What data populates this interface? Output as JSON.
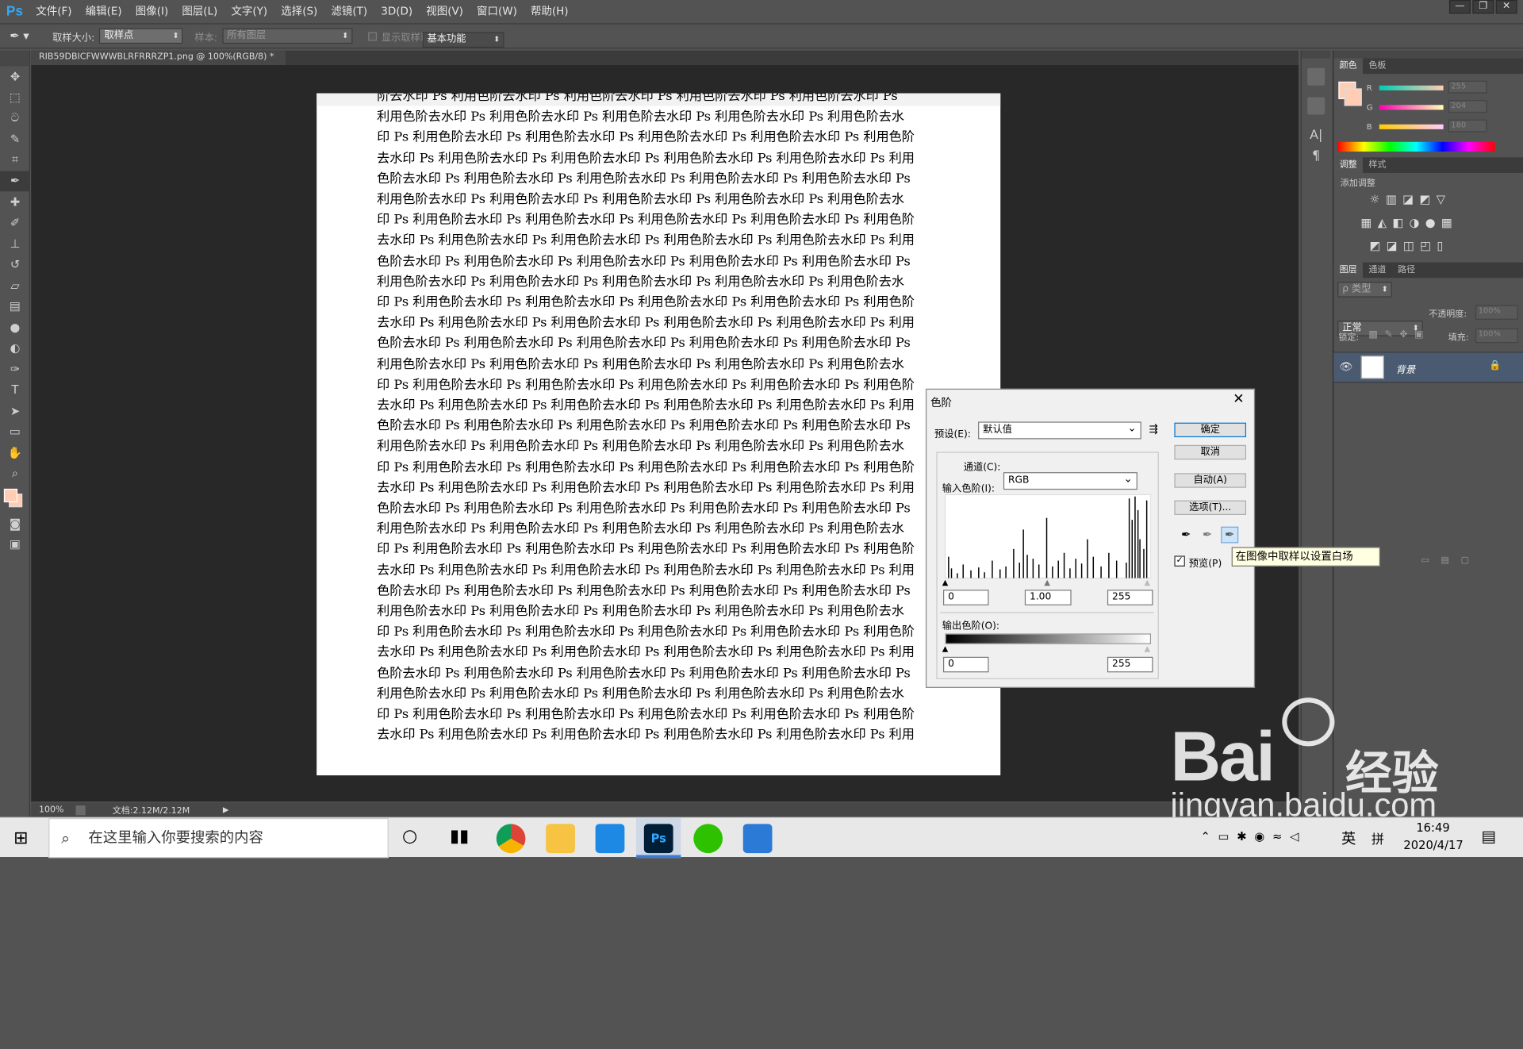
{
  "app": {
    "logo": "Ps"
  },
  "menu": [
    "文件(F)",
    "编辑(E)",
    "图像(I)",
    "图层(L)",
    "文字(Y)",
    "选择(S)",
    "滤镜(T)",
    "3D(D)",
    "视图(V)",
    "窗口(W)",
    "帮助(H)"
  ],
  "options": {
    "sample_size_label": "取样大小:",
    "sample_size_value": "取样点",
    "sample_label": "样本:",
    "sample_value": "所有图层",
    "show_ring": "显示取样环",
    "workspace": "基本功能"
  },
  "document": {
    "tab_title": "RIB59DBICFWWWBLRFRRRZP1.png @ 100%(RGB/8) *",
    "lines": [
      "阶去水印 Ps 利用色阶去水印 Ps 利用色阶去水印 Ps 利用色阶去水印 Ps 利用色阶去水印 Ps",
      "利用色阶去水印 Ps 利用色阶去水印 Ps 利用色阶去水印 Ps 利用色阶去水印 Ps 利用色阶去水",
      "印 Ps 利用色阶去水印 Ps 利用色阶去水印 Ps 利用色阶去水印 Ps 利用色阶去水印 Ps 利用色阶",
      "去水印 Ps 利用色阶去水印 Ps 利用色阶去水印 Ps 利用色阶去水印 Ps 利用色阶去水印 Ps 利用",
      "色阶去水印 Ps 利用色阶去水印 Ps 利用色阶去水印 Ps 利用色阶去水印 Ps 利用色阶去水印 Ps",
      "利用色阶去水印 Ps 利用色阶去水印 Ps 利用色阶去水印 Ps 利用色阶去水印 Ps 利用色阶去水",
      "印 Ps 利用色阶去水印 Ps 利用色阶去水印 Ps 利用色阶去水印 Ps 利用色阶去水印 Ps 利用色阶",
      "去水印 Ps 利用色阶去水印 Ps 利用色阶去水印 Ps 利用色阶去水印 Ps 利用色阶去水印 Ps 利用",
      "色阶去水印 Ps 利用色阶去水印 Ps 利用色阶去水印 Ps 利用色阶去水印 Ps 利用色阶去水印 Ps",
      "利用色阶去水印 Ps 利用色阶去水印 Ps 利用色阶去水印 Ps 利用色阶去水印 Ps 利用色阶去水",
      "印 Ps 利用色阶去水印 Ps 利用色阶去水印 Ps 利用色阶去水印 Ps 利用色阶去水印 Ps 利用色阶",
      "去水印 Ps 利用色阶去水印 Ps 利用色阶去水印 Ps 利用色阶去水印 Ps 利用色阶去水印 Ps 利用",
      "色阶去水印 Ps 利用色阶去水印 Ps 利用色阶去水印 Ps 利用色阶去水印 Ps 利用色阶去水印 Ps",
      "利用色阶去水印 Ps 利用色阶去水印 Ps 利用色阶去水印 Ps 利用色阶去水印 Ps 利用色阶去水",
      "印 Ps 利用色阶去水印 Ps 利用色阶去水印 Ps 利用色阶去水印 Ps 利用色阶去水印 Ps 利用色阶",
      "去水印 Ps 利用色阶去水印 Ps 利用色阶去水印 Ps 利用色阶去水印 Ps 利用色阶去水印 Ps 利用",
      "色阶去水印 Ps 利用色阶去水印 Ps 利用色阶去水印 Ps 利用色阶去水印 Ps 利用色阶去水印 Ps",
      "利用色阶去水印 Ps 利用色阶去水印 Ps 利用色阶去水印 Ps 利用色阶去水印 Ps 利用色阶去水",
      "印 Ps 利用色阶去水印 Ps 利用色阶去水印 Ps 利用色阶去水印 Ps 利用色阶去水印 Ps 利用色阶",
      "去水印 Ps 利用色阶去水印 Ps 利用色阶去水印 Ps 利用色阶去水印 Ps 利用色阶去水印 Ps 利用",
      "色阶去水印 Ps 利用色阶去水印 Ps 利用色阶去水印 Ps 利用色阶去水印 Ps 利用色阶去水印 Ps",
      "利用色阶去水印 Ps 利用色阶去水印 Ps 利用色阶去水印 Ps 利用色阶去水印 Ps 利用色阶去水",
      "印 Ps 利用色阶去水印 Ps 利用色阶去水印 Ps 利用色阶去水印 Ps 利用色阶去水印 Ps 利用色阶",
      "去水印 Ps 利用色阶去水印 Ps 利用色阶去水印 Ps 利用色阶去水印 Ps 利用色阶去水印 Ps 利用",
      "色阶去水印 Ps 利用色阶去水印 Ps 利用色阶去水印 Ps 利用色阶去水印 Ps 利用色阶去水印 Ps",
      "利用色阶去水印 Ps 利用色阶去水印 Ps 利用色阶去水印 Ps 利用色阶去水印 Ps 利用色阶去水",
      "印 Ps 利用色阶去水印 Ps 利用色阶去水印 Ps 利用色阶去水印 Ps 利用色阶去水印 Ps 利用色阶",
      "去水印 Ps 利用色阶去水印 Ps 利用色阶去水印 Ps 利用色阶去水印 Ps 利用色阶去水印 Ps 利用",
      "色阶去水印 Ps 利用色阶去水印 Ps 利用色阶去水印 Ps 利用色阶去水印 Ps 利用色阶去水印 Ps",
      "利用色阶去水印 Ps 利用色阶去水印 Ps 利用色阶去水印 Ps 利用色阶去水印 Ps 利用色阶去水",
      "印 Ps 利用色阶去水印 Ps 利用色阶去水印 Ps 利用色阶去水印 Ps 利用色阶去水印 Ps 利用色阶",
      "去水印 Ps 利用色阶去水印 Ps 利用色阶去水印 Ps 利用色阶去水印 Ps 利用色阶去水印 Ps 利用"
    ]
  },
  "status": {
    "zoom": "100%",
    "doc": "文档:2.12M/2.12M"
  },
  "color_panel": {
    "tab_color": "颜色",
    "tab_swatches": "色板",
    "r_label": "R",
    "g_label": "G",
    "b_label": "B",
    "r": "255",
    "g": "204",
    "b": "180",
    "fg_color": "#ffccb4"
  },
  "adjust_panel": {
    "tab_adjust": "调整",
    "tab_styles": "样式",
    "add": "添加调整"
  },
  "layers_panel": {
    "tab_layers": "图层",
    "tab_channels": "通道",
    "tab_paths": "路径",
    "kind": "ρ 类型",
    "blend": "正常",
    "opacity_label": "不透明度:",
    "opacity": "100%",
    "lock_label": "锁定:",
    "fill_label": "填充:",
    "fill": "100%",
    "layer_name": "背景"
  },
  "levels": {
    "title": "色阶",
    "preset_label": "预设(E):",
    "preset_value": "默认值",
    "channel_label": "通道(C):",
    "channel_value": "RGB",
    "input_label": "输入色阶(I):",
    "output_label": "输出色阶(O):",
    "in_black": "0",
    "in_gamma": "1.00",
    "in_white": "255",
    "out_black": "0",
    "out_white": "255",
    "ok": "确定",
    "cancel": "取消",
    "auto": "自动(A)",
    "options": "选项(T)...",
    "preview": "预览(P)",
    "tooltip": "在图像中取样以设置白场"
  },
  "taskbar": {
    "search_placeholder": "在这里输入你要搜索的内容",
    "time": "16:49",
    "date": "2020/4/17",
    "lang": "英",
    "ime": "拼"
  },
  "watermark": {
    "brand": "Bai",
    "brand2": "经验",
    "url": "jingyan.baidu.com"
  }
}
